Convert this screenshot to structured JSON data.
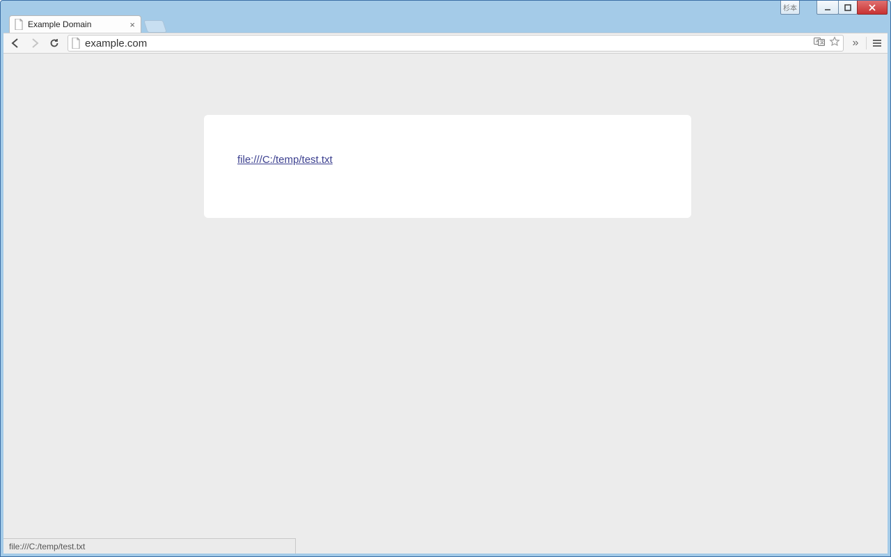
{
  "window": {
    "pin_label": "杉本",
    "controls": {
      "minimize": "minimize",
      "maximize": "maximize",
      "close": "close"
    }
  },
  "tab": {
    "title": "Example Domain",
    "close_label": "×"
  },
  "toolbar": {
    "back": "back",
    "forward": "forward",
    "reload": "reload",
    "address": "example.com",
    "translate_icon": "translate",
    "bookmark_icon": "star",
    "overflow": "»",
    "menu": "menu"
  },
  "page": {
    "link_text": "file:///C:/temp/test.txt",
    "link_href": "file:///C:/temp/test.txt"
  },
  "status": {
    "text": "file:///C:/temp/test.txt"
  }
}
